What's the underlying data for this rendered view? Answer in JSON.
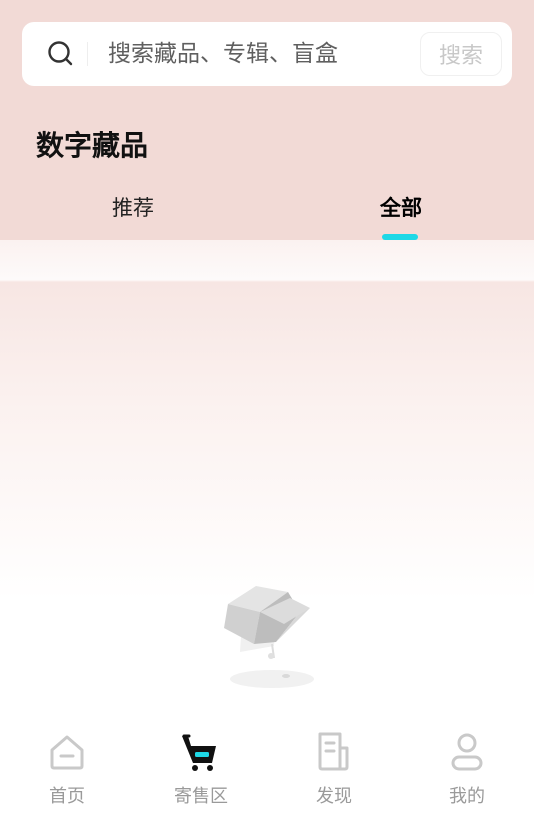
{
  "search": {
    "placeholder": "搜索藏品、专辑、盲盒",
    "button_label": "搜索"
  },
  "page_title": "数字藏品",
  "tabs": [
    {
      "label": "推荐",
      "active": false
    },
    {
      "label": "全部",
      "active": true
    }
  ],
  "colors": {
    "accent": "#1ed8e6",
    "header_bg": "#f2dad6"
  },
  "bottom_nav": {
    "items": [
      {
        "label": "首页",
        "icon": "home-icon",
        "active": false
      },
      {
        "label": "寄售区",
        "icon": "cart-icon",
        "active": true
      },
      {
        "label": "发现",
        "icon": "discover-icon",
        "active": false
      },
      {
        "label": "我的",
        "icon": "profile-icon",
        "active": false
      }
    ]
  }
}
